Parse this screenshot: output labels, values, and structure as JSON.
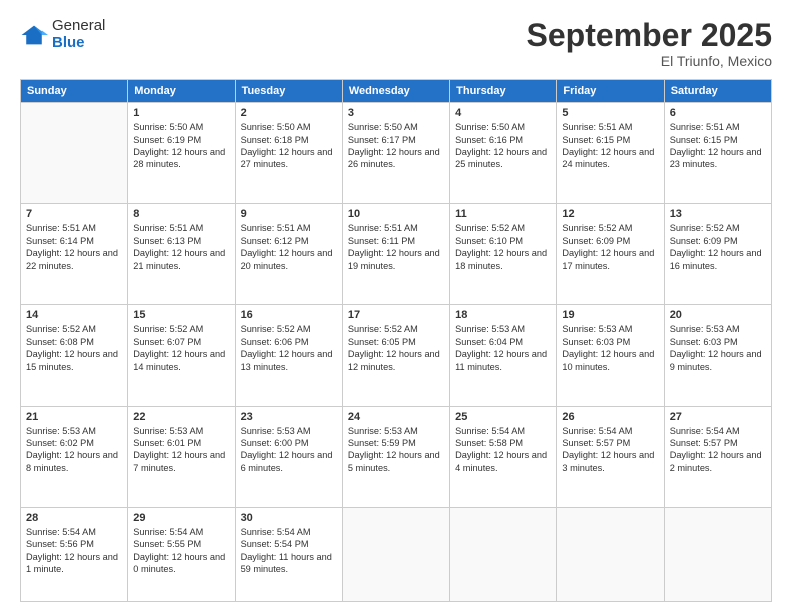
{
  "logo": {
    "general": "General",
    "blue": "Blue"
  },
  "header": {
    "month": "September 2025",
    "location": "El Triunfo, Mexico"
  },
  "weekdays": [
    "Sunday",
    "Monday",
    "Tuesday",
    "Wednesday",
    "Thursday",
    "Friday",
    "Saturday"
  ],
  "weeks": [
    [
      {
        "day": null
      },
      {
        "day": "1",
        "sunrise": "5:50 AM",
        "sunset": "6:19 PM",
        "daylight": "12 hours and 28 minutes."
      },
      {
        "day": "2",
        "sunrise": "5:50 AM",
        "sunset": "6:18 PM",
        "daylight": "12 hours and 27 minutes."
      },
      {
        "day": "3",
        "sunrise": "5:50 AM",
        "sunset": "6:17 PM",
        "daylight": "12 hours and 26 minutes."
      },
      {
        "day": "4",
        "sunrise": "5:50 AM",
        "sunset": "6:16 PM",
        "daylight": "12 hours and 25 minutes."
      },
      {
        "day": "5",
        "sunrise": "5:51 AM",
        "sunset": "6:15 PM",
        "daylight": "12 hours and 24 minutes."
      },
      {
        "day": "6",
        "sunrise": "5:51 AM",
        "sunset": "6:15 PM",
        "daylight": "12 hours and 23 minutes."
      }
    ],
    [
      {
        "day": "7",
        "sunrise": "5:51 AM",
        "sunset": "6:14 PM",
        "daylight": "12 hours and 22 minutes."
      },
      {
        "day": "8",
        "sunrise": "5:51 AM",
        "sunset": "6:13 PM",
        "daylight": "12 hours and 21 minutes."
      },
      {
        "day": "9",
        "sunrise": "5:51 AM",
        "sunset": "6:12 PM",
        "daylight": "12 hours and 20 minutes."
      },
      {
        "day": "10",
        "sunrise": "5:51 AM",
        "sunset": "6:11 PM",
        "daylight": "12 hours and 19 minutes."
      },
      {
        "day": "11",
        "sunrise": "5:52 AM",
        "sunset": "6:10 PM",
        "daylight": "12 hours and 18 minutes."
      },
      {
        "day": "12",
        "sunrise": "5:52 AM",
        "sunset": "6:09 PM",
        "daylight": "12 hours and 17 minutes."
      },
      {
        "day": "13",
        "sunrise": "5:52 AM",
        "sunset": "6:09 PM",
        "daylight": "12 hours and 16 minutes."
      }
    ],
    [
      {
        "day": "14",
        "sunrise": "5:52 AM",
        "sunset": "6:08 PM",
        "daylight": "12 hours and 15 minutes."
      },
      {
        "day": "15",
        "sunrise": "5:52 AM",
        "sunset": "6:07 PM",
        "daylight": "12 hours and 14 minutes."
      },
      {
        "day": "16",
        "sunrise": "5:52 AM",
        "sunset": "6:06 PM",
        "daylight": "12 hours and 13 minutes."
      },
      {
        "day": "17",
        "sunrise": "5:52 AM",
        "sunset": "6:05 PM",
        "daylight": "12 hours and 12 minutes."
      },
      {
        "day": "18",
        "sunrise": "5:53 AM",
        "sunset": "6:04 PM",
        "daylight": "12 hours and 11 minutes."
      },
      {
        "day": "19",
        "sunrise": "5:53 AM",
        "sunset": "6:03 PM",
        "daylight": "12 hours and 10 minutes."
      },
      {
        "day": "20",
        "sunrise": "5:53 AM",
        "sunset": "6:03 PM",
        "daylight": "12 hours and 9 minutes."
      }
    ],
    [
      {
        "day": "21",
        "sunrise": "5:53 AM",
        "sunset": "6:02 PM",
        "daylight": "12 hours and 8 minutes."
      },
      {
        "day": "22",
        "sunrise": "5:53 AM",
        "sunset": "6:01 PM",
        "daylight": "12 hours and 7 minutes."
      },
      {
        "day": "23",
        "sunrise": "5:53 AM",
        "sunset": "6:00 PM",
        "daylight": "12 hours and 6 minutes."
      },
      {
        "day": "24",
        "sunrise": "5:53 AM",
        "sunset": "5:59 PM",
        "daylight": "12 hours and 5 minutes."
      },
      {
        "day": "25",
        "sunrise": "5:54 AM",
        "sunset": "5:58 PM",
        "daylight": "12 hours and 4 minutes."
      },
      {
        "day": "26",
        "sunrise": "5:54 AM",
        "sunset": "5:57 PM",
        "daylight": "12 hours and 3 minutes."
      },
      {
        "day": "27",
        "sunrise": "5:54 AM",
        "sunset": "5:57 PM",
        "daylight": "12 hours and 2 minutes."
      }
    ],
    [
      {
        "day": "28",
        "sunrise": "5:54 AM",
        "sunset": "5:56 PM",
        "daylight": "12 hours and 1 minute."
      },
      {
        "day": "29",
        "sunrise": "5:54 AM",
        "sunset": "5:55 PM",
        "daylight": "12 hours and 0 minutes."
      },
      {
        "day": "30",
        "sunrise": "5:54 AM",
        "sunset": "5:54 PM",
        "daylight": "11 hours and 59 minutes."
      },
      {
        "day": null
      },
      {
        "day": null
      },
      {
        "day": null
      },
      {
        "day": null
      }
    ]
  ],
  "labels": {
    "sunrise": "Sunrise:",
    "sunset": "Sunset:",
    "daylight": "Daylight:"
  }
}
